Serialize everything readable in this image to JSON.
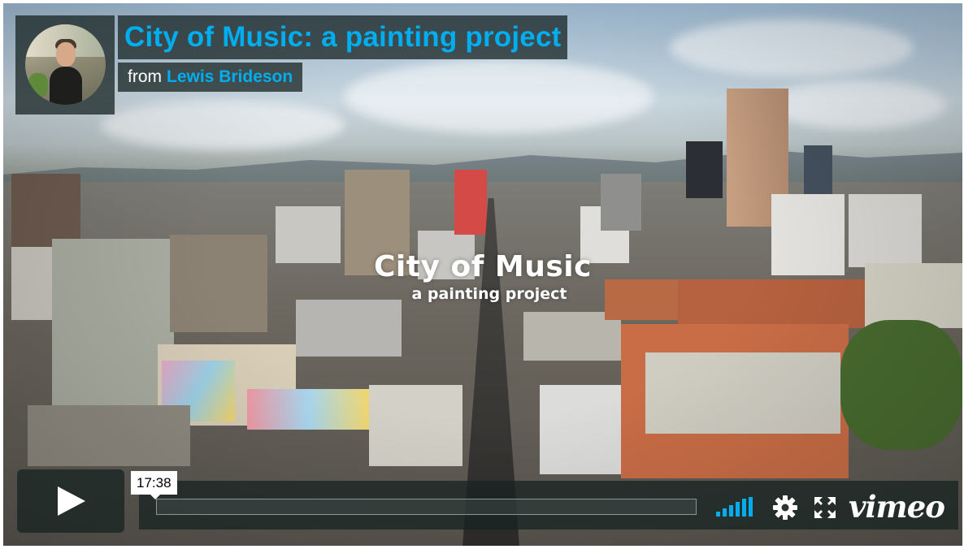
{
  "video": {
    "title": "City of Music: a painting project",
    "byline_prefix": "from",
    "author": "Lewis Brideson",
    "overlay_title": "City of Music",
    "overlay_subtitle": "a painting project"
  },
  "controls": {
    "time_tooltip": "17:38",
    "progress_fraction": 0,
    "brand": "vimeo"
  },
  "icons": {
    "play": "play-icon",
    "volume": "volume-icon",
    "settings": "gear-icon",
    "fullscreen": "fullscreen-icon"
  },
  "colors": {
    "accent": "#00adef",
    "overlay_bg": "#172322"
  }
}
